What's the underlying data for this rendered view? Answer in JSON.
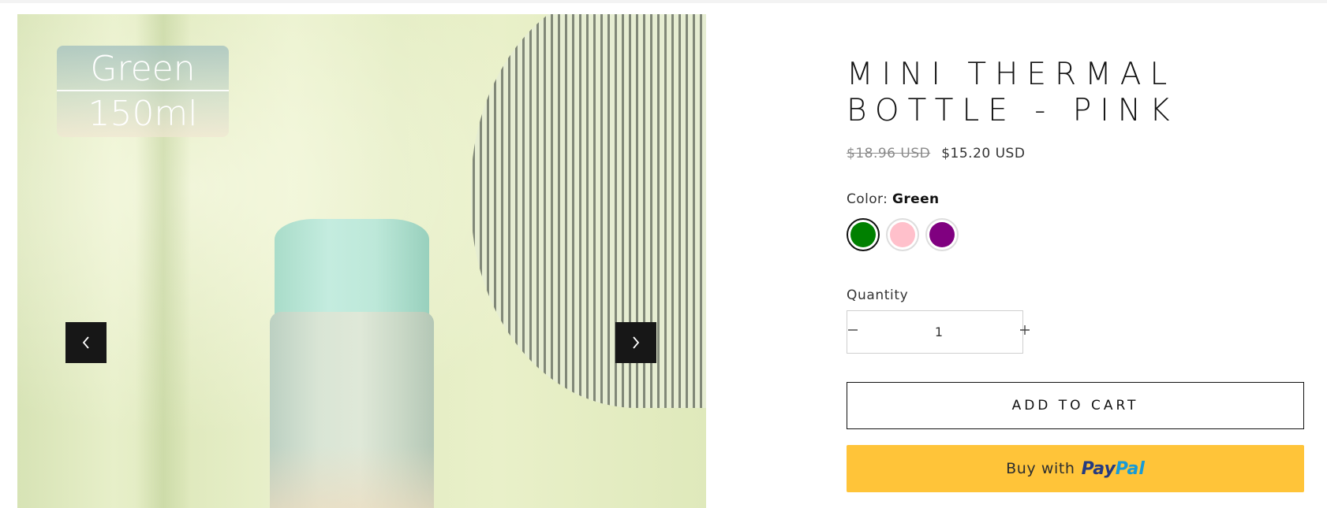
{
  "gallery": {
    "image_tag": {
      "color": "Green",
      "volume": "150ml"
    },
    "prev_icon": "chevron-left-icon",
    "next_icon": "chevron-right-icon"
  },
  "product": {
    "title_line1": "MINI THERMAL",
    "title_line2": "BOTTLE - PINK",
    "price_original": "$18.96 USD",
    "price_sale": "$15.20 USD"
  },
  "color_option": {
    "label": "Color:",
    "selected": "Green",
    "swatches": [
      {
        "name": "Green",
        "hex": "#008000",
        "selected": true
      },
      {
        "name": "Pink",
        "hex": "#ffc0cb",
        "selected": false
      },
      {
        "name": "Purple",
        "hex": "#800080",
        "selected": false
      }
    ]
  },
  "quantity": {
    "label": "Quantity",
    "value": "1",
    "minus_icon": "minus-icon",
    "plus_icon": "plus-icon"
  },
  "actions": {
    "add_to_cart": "ADD TO CART",
    "paypal_prefix": "Buy with",
    "paypal_logo_pay": "Pay",
    "paypal_logo_pal": "Pal"
  },
  "colors": {
    "paypal_yellow": "#ffc439",
    "nav_button": "#171717",
    "text": "#121212"
  }
}
